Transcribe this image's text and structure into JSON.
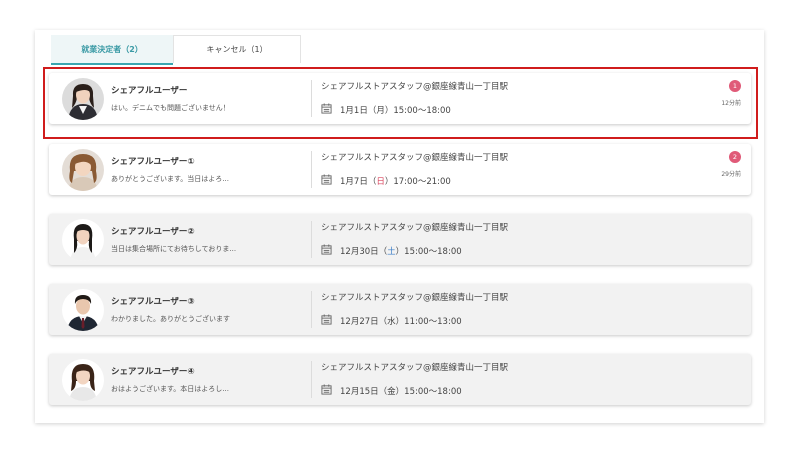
{
  "tabs": {
    "active_label": "就業決定者（2）",
    "inactive_label": "キャンセル（1）"
  },
  "colors": {
    "accent": "#3aa5b0",
    "badge": "#e05a78",
    "highlight": "#d01c1c",
    "sunday": "#d9475f",
    "saturday": "#3a7cc6"
  },
  "messages": [
    {
      "name": "シェアフルユーザー",
      "preview": "はい。デニムでも問題ございません！",
      "job": "シェアフルストアスタッフ@銀座線青山一丁目駅",
      "date_prefix": "1月1日（",
      "weekday": "月",
      "date_suffix": "）15:00〜18:00",
      "badge": "1",
      "time": "12分前",
      "unread": true,
      "avatar": "avatar-woman-1"
    },
    {
      "name": "シェアフルユーザー①",
      "preview": "ありがとうございます。当日はよろ...",
      "job": "シェアフルストアスタッフ@銀座線青山一丁目駅",
      "date_prefix": "1月7日（",
      "weekday": "日",
      "date_suffix": "）17:00〜21:00",
      "badge": "2",
      "time": "29分前",
      "unread": true,
      "avatar": "avatar-woman-2"
    },
    {
      "name": "シェアフルユーザー②",
      "preview": "当日は集合場所にてお待ちしておりま...",
      "job": "シェアフルストアスタッフ@銀座線青山一丁目駅",
      "date_prefix": "12月30日（",
      "weekday": "土",
      "date_suffix": "）15:00〜18:00",
      "unread": false,
      "avatar": "avatar-woman-3"
    },
    {
      "name": "シェアフルユーザー③",
      "preview": "わかりました。ありがとうございます",
      "job": "シェアフルストアスタッフ@銀座線青山一丁目駅",
      "date_prefix": "12月27日（",
      "weekday": "水",
      "date_suffix": "）11:00〜13:00",
      "unread": false,
      "avatar": "avatar-man"
    },
    {
      "name": "シェアフルユーザー④",
      "preview": "おはようございます。本日はよろし...",
      "job": "シェアフルストアスタッフ@銀座線青山一丁目駅",
      "date_prefix": "12月15日（",
      "weekday": "金",
      "date_suffix": "）15:00〜18:00",
      "unread": false,
      "avatar": "avatar-woman-4"
    }
  ]
}
